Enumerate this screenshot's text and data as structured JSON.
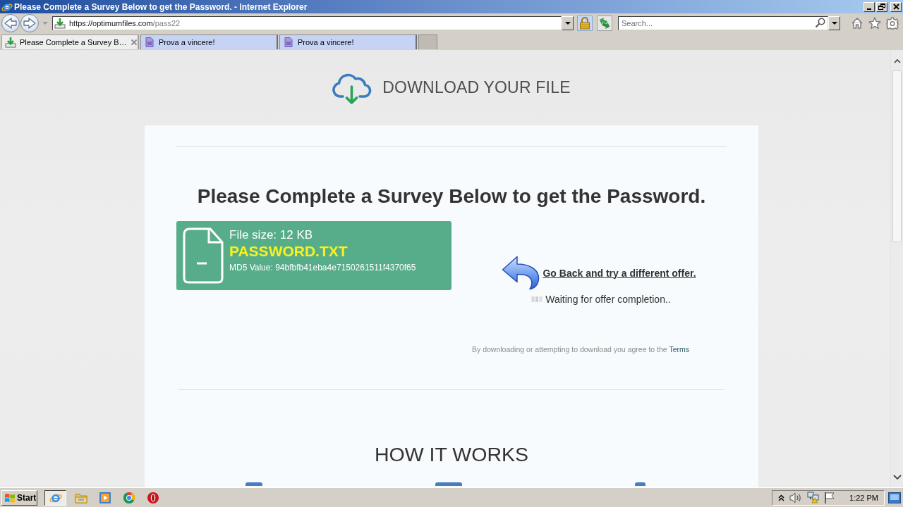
{
  "window": {
    "title": "Please Complete a Survey Below to get the Password. - Internet Explorer"
  },
  "toolbar": {
    "address": {
      "host": "https://optimumfiles.com",
      "path": "/pass22"
    },
    "search": {
      "placeholder": "Search..."
    }
  },
  "tabs": [
    {
      "kind": "download",
      "label": "Please Complete a Survey B…",
      "selected": true
    },
    {
      "kind": "page",
      "label": "Prova a vincere!",
      "selected": false
    },
    {
      "kind": "page",
      "label": "Prova a vincere!",
      "selected": false
    }
  ],
  "page": {
    "header": "DOWNLOAD YOUR FILE",
    "title": "Please Complete a Survey Below to get the Password.",
    "file": {
      "size": "File size: 12 KB",
      "name": "PASSWORD.TXT",
      "md5": "MD5 Value: 94bfbfb41eba4e7150261511f4370f65"
    },
    "go_back_link": "Go Back and try a different offer.",
    "status": "Waiting for offer completion..",
    "terms": {
      "text": "By downloading or attempting to download you agree to the",
      "link": "Terms"
    },
    "section_title": "HOW IT WORKS"
  },
  "taskbar": {
    "start": "Start",
    "clock": "1:22 PM"
  }
}
